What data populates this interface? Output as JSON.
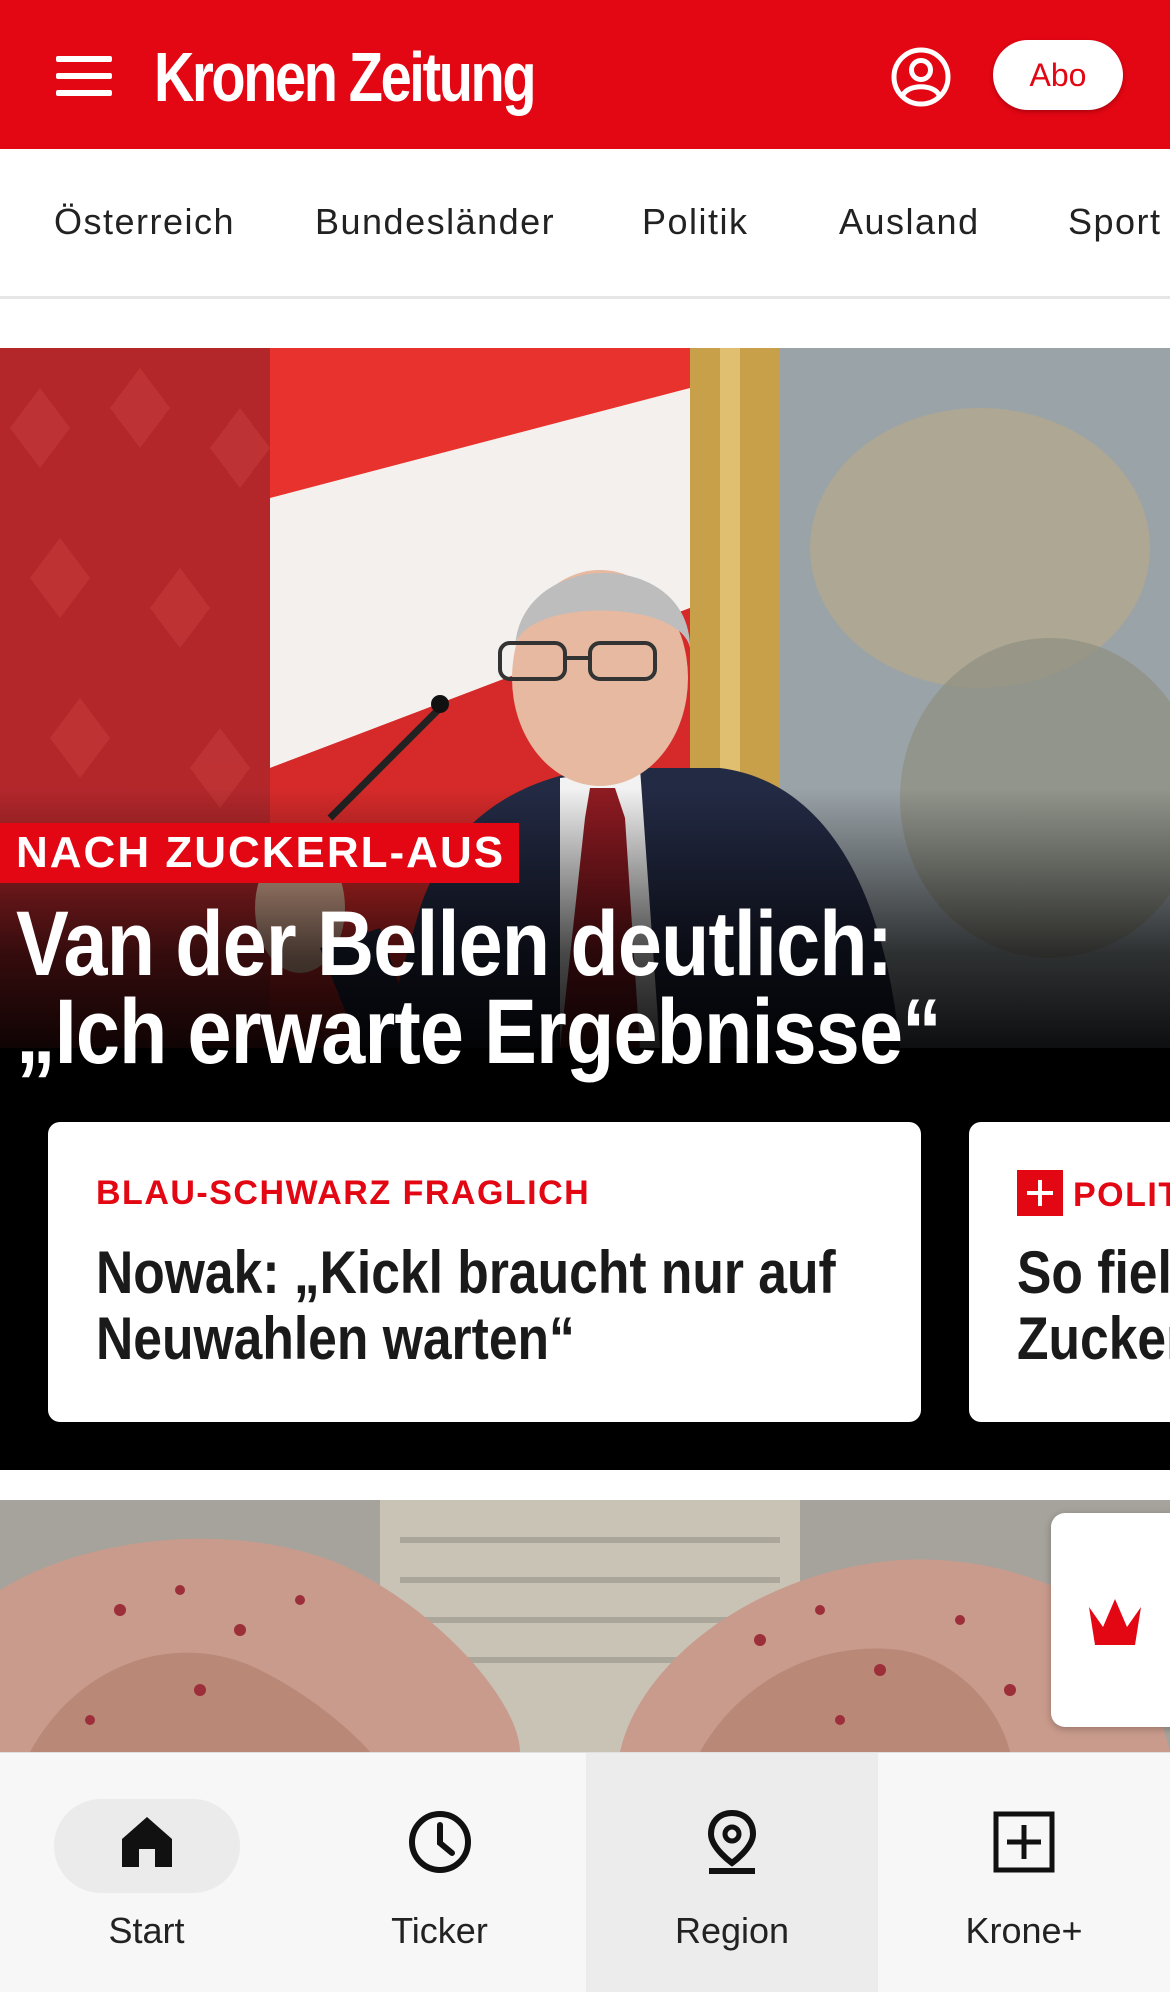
{
  "header": {
    "logo_text": "Kronen Zeitung",
    "abo_label": "Abo",
    "brand_color": "#e30613"
  },
  "categories": [
    "Österreich",
    "Bundesländer",
    "Politik",
    "Ausland",
    "Sport"
  ],
  "hero": {
    "kicker": "NACH ZUCKERL-AUS",
    "headline_line1": "Van der Bellen deutlich:",
    "headline_line2": "„Ich erwarte Ergebnisse“"
  },
  "cards": [
    {
      "kicker": "BLAU-SCHWARZ FRAGLICH",
      "title_line1": "Nowak: „Kickl braucht nur auf",
      "title_line2": "Neuwahlen warten“"
    },
    {
      "kicker": "POLIT",
      "plus": true,
      "title_line1": "So fiel",
      "title_line2": "Zucker"
    }
  ],
  "bottom_nav": [
    {
      "label": "Start",
      "icon": "home-icon",
      "active": true
    },
    {
      "label": "Ticker",
      "icon": "clock-icon",
      "active": false
    },
    {
      "label": "Region",
      "icon": "location-pin-icon",
      "active": false
    },
    {
      "label": "Krone+",
      "icon": "plus-square-icon",
      "active": false
    }
  ]
}
